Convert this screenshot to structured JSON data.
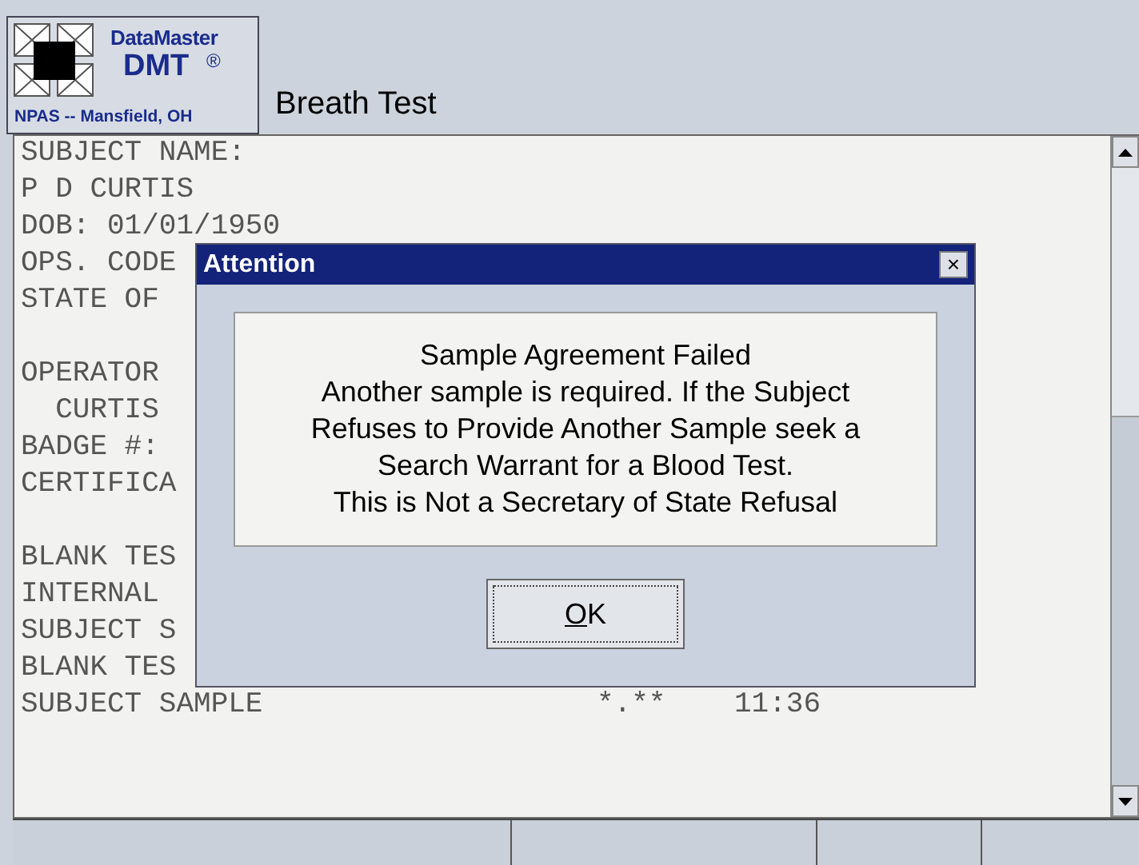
{
  "header": {
    "logo": {
      "brand": "DataMaster",
      "model": "DMT",
      "mark": "®",
      "location": "NPAS -- Mansfield, OH"
    },
    "title": "Breath Test"
  },
  "record": {
    "sections": [
      {
        "lines": [
          {
            "label": "SUBJECT NAME:"
          },
          {
            "label": "P D CURTIS"
          },
          {
            "label": "DOB: 01/01/1950"
          },
          {
            "label": "OPS. CODE"
          },
          {
            "label": "STATE OF"
          }
        ]
      },
      {
        "lines": [
          {
            "label": "OPERATOR"
          },
          {
            "label": "  CURTIS"
          },
          {
            "label": "BADGE #:"
          },
          {
            "label": "CERTIFICA"
          }
        ]
      },
      {
        "lines": [
          {
            "label": "BLANK TES"
          },
          {
            "label": "INTERNAL"
          },
          {
            "label": "SUBJECT S"
          },
          {
            "label": "BLANK TES"
          },
          {
            "label": "SUBJECT SAMPLE",
            "result": "*.**",
            "time": "11:36"
          }
        ]
      }
    ]
  },
  "dialog": {
    "title": "Attention",
    "close": "×",
    "message": [
      "Sample Agreement Failed",
      "Another sample is required. If the Subject",
      "Refuses to Provide Another Sample seek a",
      "Search Warrant for a Blood Test.",
      "This is Not a Secretary of State Refusal"
    ],
    "button": {
      "label": "OK",
      "focused": true,
      "mnemonic_underlined": true
    }
  }
}
